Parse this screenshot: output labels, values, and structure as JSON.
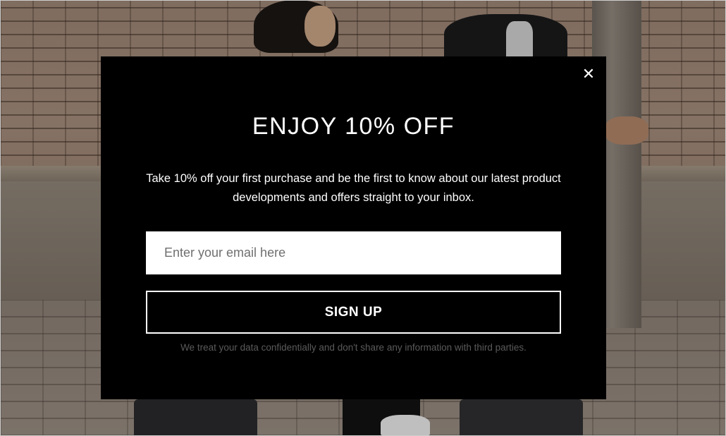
{
  "popup": {
    "title": "ENJOY 10% OFF",
    "description": "Take 10% off your first purchase and be the first to know about our latest product developments and offers straight to your inbox.",
    "email_placeholder": "Enter your email here",
    "email_value": "",
    "signup_label": "SIGN UP",
    "close_icon": "close-icon",
    "close_glyph": "✕",
    "disclaimer": "We treat your data confidentially and don't share any information with third parties."
  },
  "colors": {
    "modal_bg": "#000000",
    "text": "#ffffff",
    "disclaimer": "#5a5a5a"
  }
}
